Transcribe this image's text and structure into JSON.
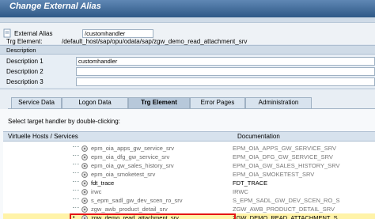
{
  "title": "Change External Alias",
  "alias": {
    "label": "External Alias",
    "value": "/customhandler",
    "trg_label": "Trg Element:",
    "trg_path": "/default_host/sap/opu/odata/sap/zgw_demo_read_attachment_srv"
  },
  "description": {
    "header": "Description",
    "rows": [
      {
        "label": "Description 1",
        "value": "customhandler"
      },
      {
        "label": "Description 2",
        "value": ""
      },
      {
        "label": "Description 3",
        "value": ""
      }
    ]
  },
  "tabs": [
    "Service Data",
    "Logon Data",
    "Trg Element",
    "Error Pages",
    "Administration"
  ],
  "active_tab": "Trg Element",
  "panel": {
    "hint": "Select target handler by double-clicking:",
    "col1": "Virtuelle Hosts / Services",
    "col2": "Documentation",
    "rows": [
      {
        "name": "epm_oia_apps_gw_service_srv",
        "doc": "EPM_OIA_APPS_GW_SERVICE_SRV"
      },
      {
        "name": "epm_oia_dfg_gw_service_srv",
        "doc": "EPM_OIA_DFG_GW_SERVICE_SRV"
      },
      {
        "name": "epm_oia_gw_sales_history_srv",
        "doc": "EPM_OIA_GW_SALES_HISTORY_SRV"
      },
      {
        "name": "epm_oia_smoketest_srv",
        "doc": "EPM_OIA_SMOKETEST_SRV"
      },
      {
        "name": "fdt_trace",
        "doc": "FDT_TRACE"
      },
      {
        "name": "irwc",
        "doc": "IRWC"
      },
      {
        "name": "s_epm_sadl_gw_dev_scen_ro_srv",
        "doc": "S_EPM_SADL_GW_DEV_SCEN_RO_S"
      },
      {
        "name": "zgw_awb_product_detail_srv",
        "doc": "ZGW_AWB_PRODUCT_DETAIL_SRV"
      },
      {
        "name": "zgw_demo_read_attachment_srv",
        "doc": "ZGW_DEMO_READ_ATTACHMENT_S"
      }
    ]
  }
}
